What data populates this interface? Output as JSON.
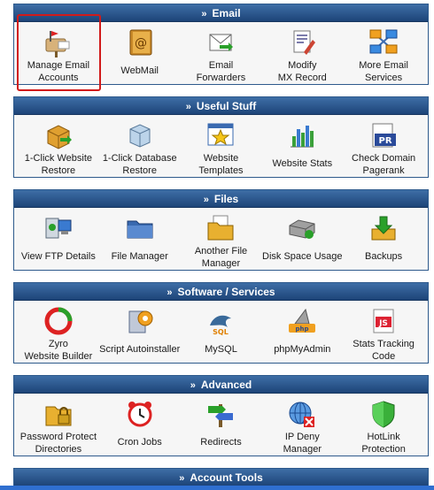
{
  "sections": [
    {
      "title": "Email",
      "items": [
        {
          "label": "Manage Email\nAccounts",
          "icon": "mailbox-icon"
        },
        {
          "label": "WebMail",
          "icon": "address-book-icon"
        },
        {
          "label": "Email\nForwarders",
          "icon": "forward-mail-icon"
        },
        {
          "label": "Modify\nMX Record",
          "icon": "mx-record-icon"
        },
        {
          "label": "More Email\nServices",
          "icon": "network-icon"
        }
      ]
    },
    {
      "title": "Useful Stuff",
      "items": [
        {
          "label": "1-Click Website\nRestore",
          "icon": "box-restore-icon"
        },
        {
          "label": "1-Click Database\nRestore",
          "icon": "database-restore-icon"
        },
        {
          "label": "Website\nTemplates",
          "icon": "template-star-icon"
        },
        {
          "label": "Website Stats",
          "icon": "bar-chart-icon"
        },
        {
          "label": "Check Domain\nPagerank",
          "icon": "pagerank-icon"
        }
      ]
    },
    {
      "title": "Files",
      "items": [
        {
          "label": "View FTP Details",
          "icon": "ftp-computer-icon"
        },
        {
          "label": "File Manager",
          "icon": "folder-icon"
        },
        {
          "label": "Another File\nManager",
          "icon": "folder-documents-icon"
        },
        {
          "label": "Disk Space Usage",
          "icon": "disk-drive-icon"
        },
        {
          "label": "Backups",
          "icon": "download-box-icon"
        }
      ]
    },
    {
      "title": "Software / Services",
      "items": [
        {
          "label": "Zyro\nWebsite Builder",
          "icon": "zyro-logo-icon"
        },
        {
          "label": "Script Autoinstaller",
          "icon": "installer-icon"
        },
        {
          "label": "MySQL",
          "icon": "mysql-dolphin-icon"
        },
        {
          "label": "phpMyAdmin",
          "icon": "phpmyadmin-icon"
        },
        {
          "label": "Stats Tracking\nCode",
          "icon": "js-code-icon"
        }
      ]
    },
    {
      "title": "Advanced",
      "items": [
        {
          "label": "Password Protect\nDirectories",
          "icon": "locked-folder-icon"
        },
        {
          "label": "Cron Jobs",
          "icon": "alarm-clock-icon"
        },
        {
          "label": "Redirects",
          "icon": "direction-sign-icon"
        },
        {
          "label": "IP Deny\nManager",
          "icon": "globe-deny-icon"
        },
        {
          "label": "HotLink\nProtection",
          "icon": "shield-icon"
        }
      ]
    },
    {
      "title": "Account Tools",
      "items": []
    }
  ],
  "colors": {
    "header_top": "#3e6ea6",
    "header_bottom": "#1d4478",
    "panel_bg": "#f6f6f6",
    "highlight": "#d11a1a"
  }
}
